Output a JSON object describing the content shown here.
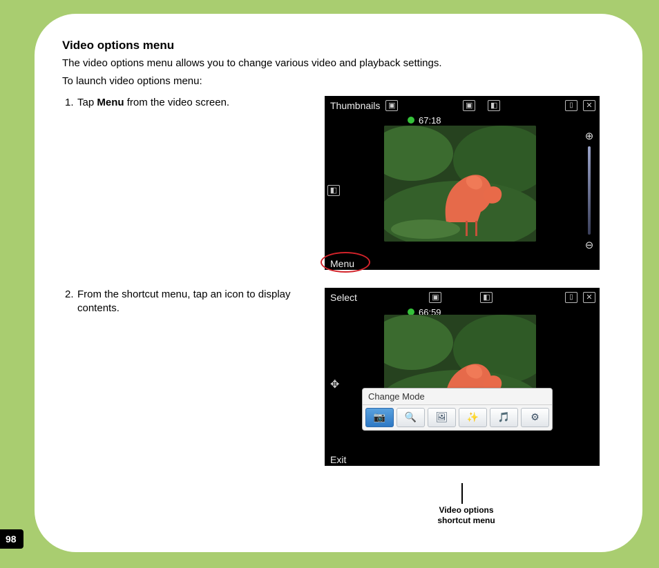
{
  "page_number": "98",
  "section": {
    "title": "Video options menu",
    "intro": "The video options menu allows you to change various video and playback settings.",
    "launch_prompt": "To launch video options menu:"
  },
  "steps": [
    {
      "num": "1.",
      "pre": "Tap ",
      "bold": "Menu",
      "post": " from the video screen."
    },
    {
      "num": "2.",
      "pre": "From the shortcut menu, tap an icon to display contents.",
      "bold": "",
      "post": ""
    }
  ],
  "shot1": {
    "top_left_label": "Thumbnails",
    "timer": "67:18",
    "bottom_label": "Menu"
  },
  "shot2": {
    "top_left_label": "Select",
    "timer": "66:59",
    "bottom_label": "Exit",
    "popup_title": "Change Mode",
    "popup_icons": [
      "camera",
      "zoom",
      "image",
      "effects",
      "audio",
      "settings"
    ]
  },
  "callout": {
    "line1": "Video options",
    "line2": "shortcut menu"
  }
}
